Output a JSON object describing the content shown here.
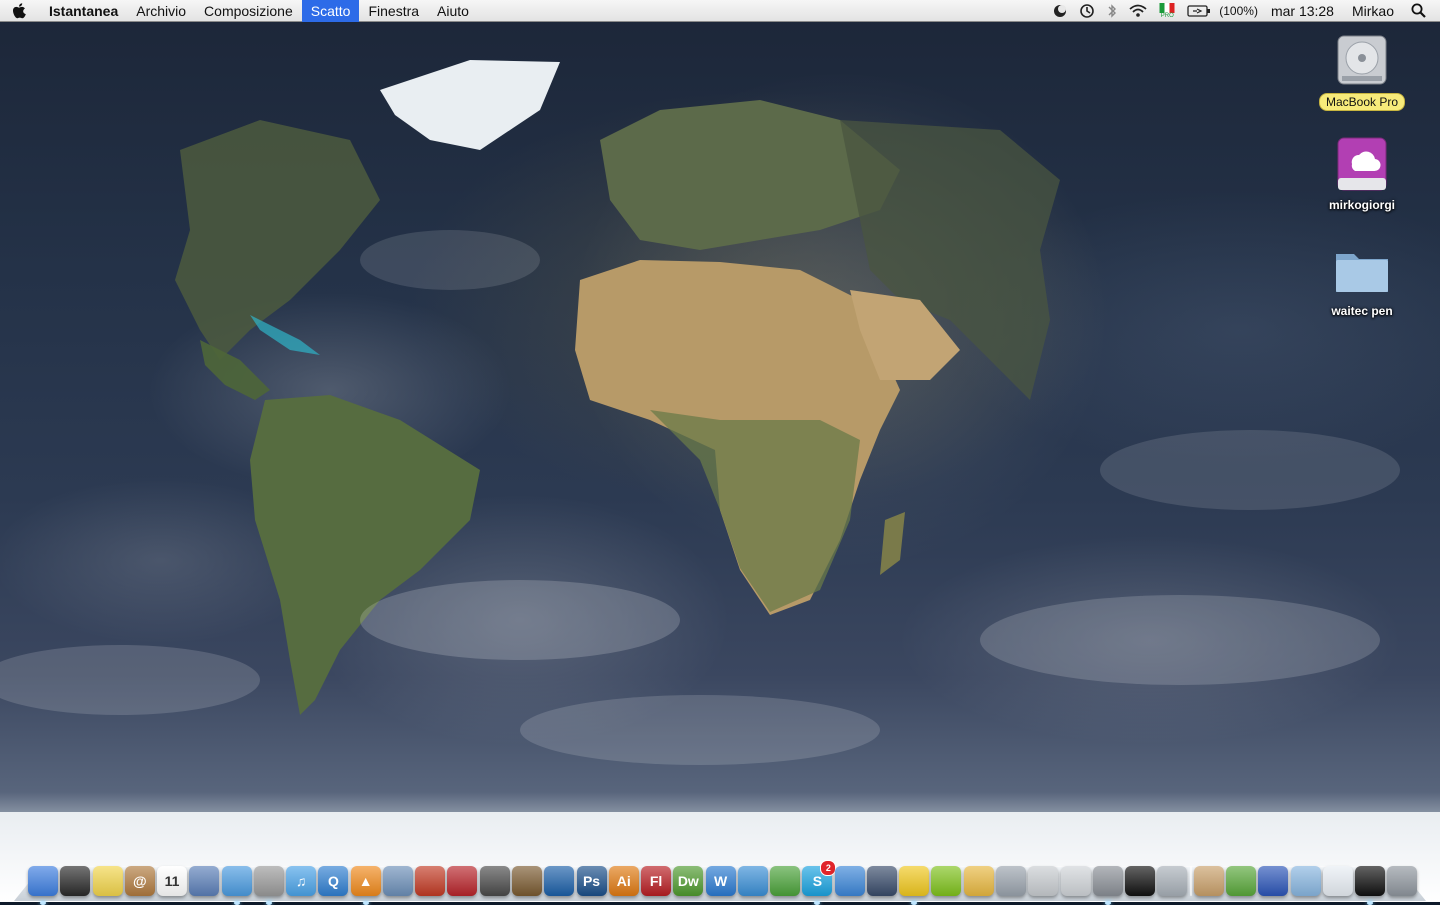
{
  "menubar": {
    "app_name": "Istantanea",
    "menus": [
      "Archivio",
      "Composizione",
      "Scatto",
      "Finestra",
      "Aiuto"
    ],
    "active_menu": "Scatto",
    "battery_percent": "(100%)",
    "clock": "mar 13:28",
    "user": "Mirkao",
    "status_icons": [
      "dashboard-moon-icon",
      "time-machine-icon",
      "bluetooth-icon",
      "wifi-icon",
      "italian-flag-input-icon",
      "battery-icon",
      "spotlight-icon"
    ],
    "input_flag_label": "PRO"
  },
  "desktop": {
    "icons": [
      {
        "label": "MacBook Pro",
        "kind": "hard-drive",
        "selected": true
      },
      {
        "label": "mirkogiorgi",
        "kind": "idisk",
        "selected": false
      },
      {
        "label": "waitec pen",
        "kind": "folder",
        "selected": false
      }
    ]
  },
  "dock": {
    "items": [
      {
        "name": "finder",
        "glyph": "",
        "color": "#3d7ee0"
      },
      {
        "name": "dashboard",
        "glyph": "",
        "color": "#2a2a2a"
      },
      {
        "name": "stickies",
        "glyph": "",
        "color": "#f2d54b"
      },
      {
        "name": "address-book",
        "glyph": "@",
        "color": "#b07a3e"
      },
      {
        "name": "ical",
        "glyph": "11",
        "color": "#ffffff"
      },
      {
        "name": "preview",
        "glyph": "",
        "color": "#5b7fb8"
      },
      {
        "name": "safari",
        "glyph": "",
        "color": "#4a9be0"
      },
      {
        "name": "dvd-player",
        "glyph": "",
        "color": "#9a9a9a"
      },
      {
        "name": "itunes",
        "glyph": "♫",
        "color": "#4aa3e8"
      },
      {
        "name": "quicktime",
        "glyph": "Q",
        "color": "#2f7fd1"
      },
      {
        "name": "vlc",
        "glyph": "▲",
        "color": "#f08a1c"
      },
      {
        "name": "iphoto",
        "glyph": "",
        "color": "#6c8fb8"
      },
      {
        "name": "photo-booth",
        "glyph": "",
        "color": "#c23a24"
      },
      {
        "name": "front-row",
        "glyph": "",
        "color": "#b8242a"
      },
      {
        "name": "image-capture",
        "glyph": "",
        "color": "#4a4a4a"
      },
      {
        "name": "screenshot-app",
        "glyph": "",
        "color": "#7a5a30"
      },
      {
        "name": "idvd",
        "glyph": "",
        "color": "#1b5fa8"
      },
      {
        "name": "photoshop",
        "glyph": "Ps",
        "color": "#1a4f8a"
      },
      {
        "name": "illustrator",
        "glyph": "Ai",
        "color": "#e07a12"
      },
      {
        "name": "flash",
        "glyph": "Fl",
        "color": "#b81d22"
      },
      {
        "name": "dreamweaver",
        "glyph": "Dw",
        "color": "#4e9a2e"
      },
      {
        "name": "word",
        "glyph": "W",
        "color": "#2a7ad1"
      },
      {
        "name": "messenger",
        "glyph": "",
        "color": "#3a8fd6"
      },
      {
        "name": "adium",
        "glyph": "",
        "color": "#4ba33a"
      },
      {
        "name": "skype",
        "glyph": "S",
        "color": "#1aa3e0",
        "badge": "2"
      },
      {
        "name": "ichat",
        "glyph": "",
        "color": "#3b86d8"
      },
      {
        "name": "spaces",
        "glyph": "",
        "color": "#384b6a"
      },
      {
        "name": "cyberduck",
        "glyph": "",
        "color": "#f0c81e"
      },
      {
        "name": "utorrent",
        "glyph": "",
        "color": "#7fc21c"
      },
      {
        "name": "stuffit",
        "glyph": "",
        "color": "#e8b840"
      },
      {
        "name": "system-profiler",
        "glyph": "",
        "color": "#9aa3ad"
      },
      {
        "name": "printer-setup",
        "glyph": "",
        "color": "#c8ccd0"
      },
      {
        "name": "hp-printer",
        "glyph": "",
        "color": "#d0d4d8"
      },
      {
        "name": "system-preferences",
        "glyph": "",
        "color": "#8a8f96"
      },
      {
        "name": "terminal",
        "glyph": "",
        "color": "#111111"
      },
      {
        "name": "utility",
        "glyph": "",
        "color": "#a8b0b8"
      },
      {
        "name": "sep",
        "glyph": "",
        "color": ""
      },
      {
        "name": "stack-pictures",
        "glyph": "",
        "color": "#c9a06a"
      },
      {
        "name": "stack-apps",
        "glyph": "",
        "color": "#59a83a"
      },
      {
        "name": "network-globe",
        "glyph": "",
        "color": "#2b55b8"
      },
      {
        "name": "documents-folder",
        "glyph": "",
        "color": "#88b6e0"
      },
      {
        "name": "downloads-stack",
        "glyph": "",
        "color": "#e8eef4"
      },
      {
        "name": "screen-sharing",
        "glyph": "",
        "color": "#101010"
      },
      {
        "name": "trash",
        "glyph": "",
        "color": "#8f969e"
      }
    ],
    "running": [
      "finder",
      "safari",
      "dvd-player",
      "vlc",
      "skype",
      "cyberduck",
      "system-preferences",
      "screen-sharing"
    ]
  }
}
